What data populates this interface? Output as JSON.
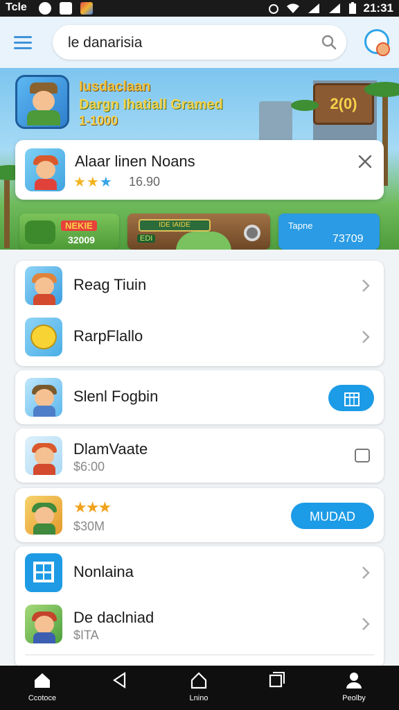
{
  "status_bar": {
    "carrier": "Tcle",
    "time": "21:31"
  },
  "header": {
    "search": {
      "value": "le danarisia"
    },
    "icons": [
      "menu-icon",
      "search-icon",
      "avatar-icon"
    ]
  },
  "banner": {
    "title": "Iusdaclaan",
    "subtitle": "Dargn Ihatiall Gramed",
    "number": "1-1000",
    "sign_text": "2(0)"
  },
  "notification": {
    "title": "Alaar linen Noans",
    "rating": 2.5,
    "count": "16.90"
  },
  "promos": [
    {
      "tag": "NEKIE",
      "value": "32009"
    },
    {
      "tag": "IDE IAIDE",
      "label": "EDI"
    },
    {
      "tag": "Tapne",
      "value": "73709"
    }
  ],
  "list": {
    "group1": [
      {
        "label": "Reag Tiuin"
      },
      {
        "label": "RarpFlallo"
      }
    ],
    "row_slenl": {
      "label": "Slenl Fogbin"
    },
    "row_darn": {
      "label": "DlamVaate",
      "sub": "$6:00"
    },
    "row_stars": {
      "sub": "$30M",
      "button": "MUDAD"
    },
    "group2": [
      {
        "label": "Nonlaina"
      },
      {
        "label": "De daclniad",
        "sub": "$ITA"
      }
    ]
  },
  "bottom_nav": [
    {
      "label": "Ccotoce",
      "icon": "home-icon"
    },
    {
      "label": "",
      "icon": "back-icon"
    },
    {
      "label": "Lnino",
      "icon": "house-outline-icon"
    },
    {
      "label": "",
      "icon": "recents-icon"
    },
    {
      "label": "Peolby",
      "icon": "profile-icon"
    }
  ],
  "colors": {
    "accent": "#1c9be6",
    "header_bg": "#e8f3fb",
    "nav_bg": "#0f0f0f"
  }
}
